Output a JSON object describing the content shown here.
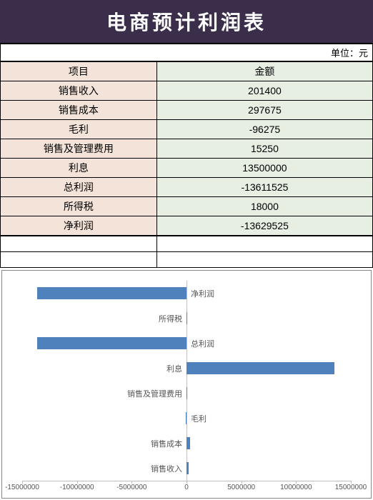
{
  "title": "电商预计利润表",
  "unit_label": "单位：元",
  "headers": {
    "item": "项目",
    "amount": "金额"
  },
  "rows": [
    {
      "label": "销售收入",
      "value": "201400"
    },
    {
      "label": "销售成本",
      "value": "297675"
    },
    {
      "label": "毛利",
      "value": "-96275"
    },
    {
      "label": "销售及管理费用",
      "value": "15250"
    },
    {
      "label": "利息",
      "value": "13500000"
    },
    {
      "label": "总利润",
      "value": "-13611525"
    },
    {
      "label": "所得税",
      "value": "18000"
    },
    {
      "label": "净利润",
      "value": "-13629525"
    }
  ],
  "chart_data": {
    "type": "bar",
    "orientation": "horizontal",
    "xlabel": "",
    "ylabel": "",
    "title": "",
    "xlim": [
      -15000000,
      15000000
    ],
    "x_ticks": [
      -15000000,
      -10000000,
      -5000000,
      0,
      5000000,
      10000000,
      15000000
    ],
    "categories": [
      "净利润",
      "所得税",
      "总利润",
      "利息",
      "销售及管理费用",
      "毛利",
      "销售成本",
      "销售收入"
    ],
    "values": [
      -13629525,
      18000,
      -13611525,
      13500000,
      15250,
      -96275,
      297675,
      201400
    ],
    "bar_color": "#4f81bd"
  }
}
